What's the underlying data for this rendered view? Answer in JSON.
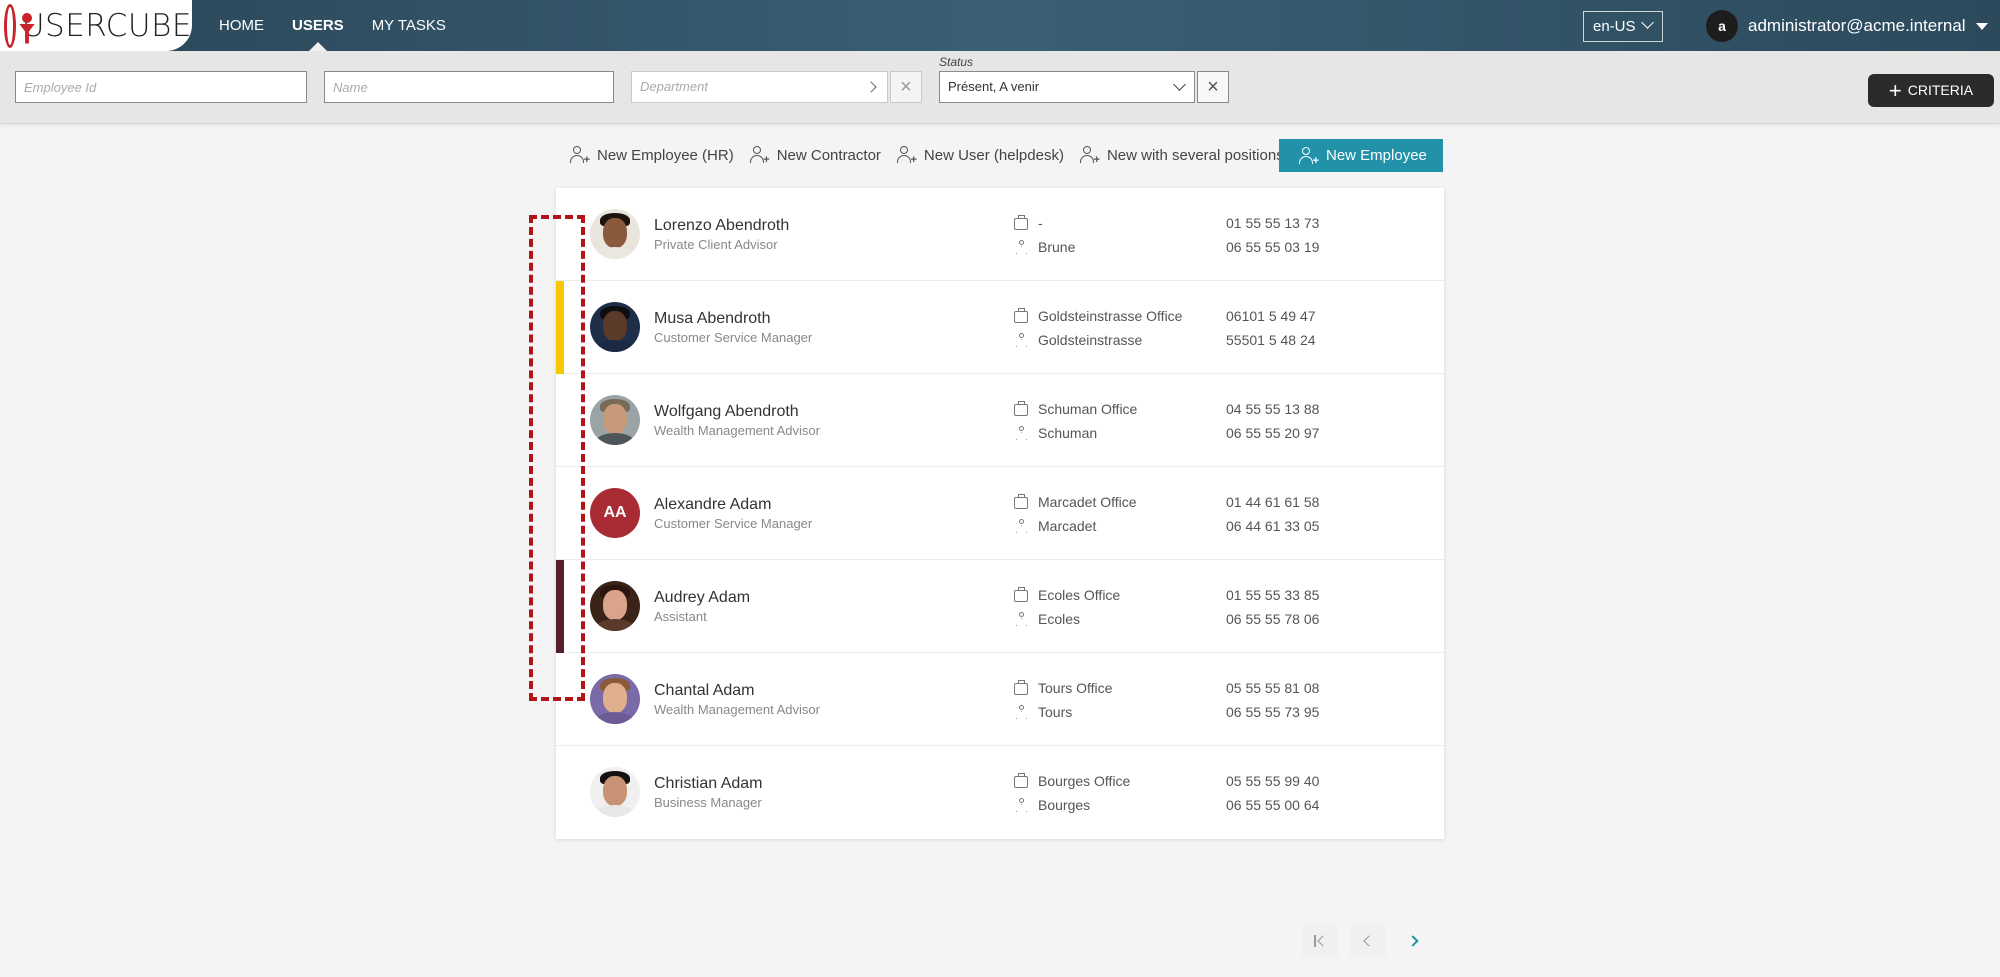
{
  "app": {
    "logo_text": "USERCUBE",
    "nav": [
      {
        "label": "HOME"
      },
      {
        "label": "USERS"
      },
      {
        "label": "MY TASKS"
      }
    ],
    "language": "en-US",
    "user": {
      "initial": "a",
      "email": "administrator@acme.internal"
    }
  },
  "filters": {
    "employee_id_placeholder": "Employee Id",
    "name_placeholder": "Name",
    "department_placeholder": "Department",
    "status_label": "Status",
    "status_value": "Présent, A venir",
    "criteria_label": "CRITERIA"
  },
  "actions": {
    "items": [
      {
        "label": "New Employee (HR)"
      },
      {
        "label": "New Contractor"
      },
      {
        "label": "New User (helpdesk)"
      },
      {
        "label": "New with several positions"
      }
    ],
    "primary_label": "New Employee"
  },
  "colors": {
    "accent": "#2192a8",
    "flag_yellow": "#f5c800",
    "flag_maroon": "#5a1e2a",
    "annotation": "#b21418"
  },
  "employees": [
    {
      "name": "Lorenzo Abendroth",
      "title": "Private Client Advisor",
      "office": "-",
      "site": "Brune",
      "phone1": "01 55 55 13 73",
      "phone2": "06 55 55 03 19",
      "flag": ""
    },
    {
      "name": "Musa Abendroth",
      "title": "Customer Service Manager",
      "office": "Goldsteinstrasse Office",
      "site": "Goldsteinstrasse",
      "phone1": "06101 5 49 47",
      "phone2": "55501 5 48 24",
      "flag": "#f5c800"
    },
    {
      "name": "Wolfgang Abendroth",
      "title": "Wealth Management Advisor",
      "office": "Schuman Office",
      "site": "Schuman",
      "phone1": "04 55 55 13 88",
      "phone2": "06 55 55 20 97",
      "flag": ""
    },
    {
      "name": "Alexandre Adam",
      "title": "Customer Service Manager",
      "office": "Marcadet Office",
      "site": "Marcadet",
      "phone1": "01 44 61 61 58",
      "phone2": "06 44 61 33 05",
      "flag": "",
      "initials": "AA"
    },
    {
      "name": "Audrey Adam",
      "title": "Assistant",
      "office": "Ecoles Office",
      "site": "Ecoles",
      "phone1": "01 55 55 33 85",
      "phone2": "06 55 55 78 06",
      "flag": "#5a1e2a"
    },
    {
      "name": "Chantal Adam",
      "title": "Wealth Management Advisor",
      "office": "Tours Office",
      "site": "Tours",
      "phone1": "05 55 55 81 08",
      "phone2": "06 55 55 73 95",
      "flag": ""
    },
    {
      "name": "Christian Adam",
      "title": "Business Manager",
      "office": "Bourges Office",
      "site": "Bourges",
      "phone1": "05 55 55 99 40",
      "phone2": "06 55 55 00 64",
      "flag": ""
    }
  ]
}
